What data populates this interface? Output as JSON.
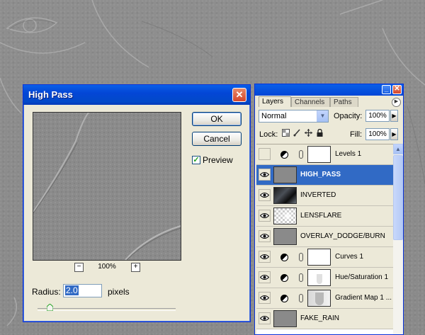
{
  "dialog": {
    "title": "High Pass",
    "close_glyph": "✕",
    "ok_label": "OK",
    "cancel_label": "Cancel",
    "preview_label": "Preview",
    "preview_checked": true,
    "check_glyph": "✓",
    "zoom_level": "100%",
    "zoom_out_glyph": "−",
    "zoom_in_glyph": "+",
    "radius_label": "Radius:",
    "radius_value": "2.0",
    "units_label": "pixels",
    "radius_slider_fraction": 0.07
  },
  "layers_panel": {
    "minimize_glyph": "_",
    "close_glyph": "✕",
    "tabs": [
      "Layers",
      "Channels",
      "Paths"
    ],
    "active_tab": "Layers",
    "panel_menu_glyph": "▶",
    "blend_mode": "Normal",
    "opacity_label": "Opacity:",
    "opacity_value": "100%",
    "lock_label": "Lock:",
    "fill_label": "Fill:",
    "fill_value": "100%",
    "arrow_glyph": "▶",
    "dropdown_glyph": "▼",
    "scroll_up_glyph": "▲",
    "layers": [
      {
        "name": "Levels 1",
        "visible": false,
        "adjustment": true,
        "thumb": "white"
      },
      {
        "name": "HIGH_PASS",
        "visible": true,
        "adjustment": false,
        "thumb": "gray",
        "selected": true
      },
      {
        "name": "INVERTED",
        "visible": true,
        "adjustment": false,
        "thumb": "dark-photo"
      },
      {
        "name": "LENSFLARE",
        "visible": true,
        "adjustment": false,
        "thumb": "checker"
      },
      {
        "name": "OVERLAY_DODGE/BURN",
        "visible": true,
        "adjustment": false,
        "thumb": "gray"
      },
      {
        "name": "Curves 1",
        "visible": true,
        "adjustment": true,
        "thumb": "white"
      },
      {
        "name": "Hue/Saturation 1",
        "visible": true,
        "adjustment": true,
        "thumb": "white-mask"
      },
      {
        "name": "Gradient Map 1 ...",
        "visible": true,
        "adjustment": true,
        "thumb": "gray-mask"
      },
      {
        "name": "FAKE_RAIN",
        "visible": true,
        "adjustment": false,
        "thumb": "gray"
      }
    ]
  },
  "icons": {
    "eye": "eye-icon",
    "adjustment": "adjustment-layer-icon",
    "chain": "link-chain-icon",
    "lock_transparent": "lock-transparent-pixels-icon",
    "lock_paint": "lock-image-pixels-icon",
    "lock_move": "lock-position-icon",
    "lock_all": "lock-all-icon"
  }
}
